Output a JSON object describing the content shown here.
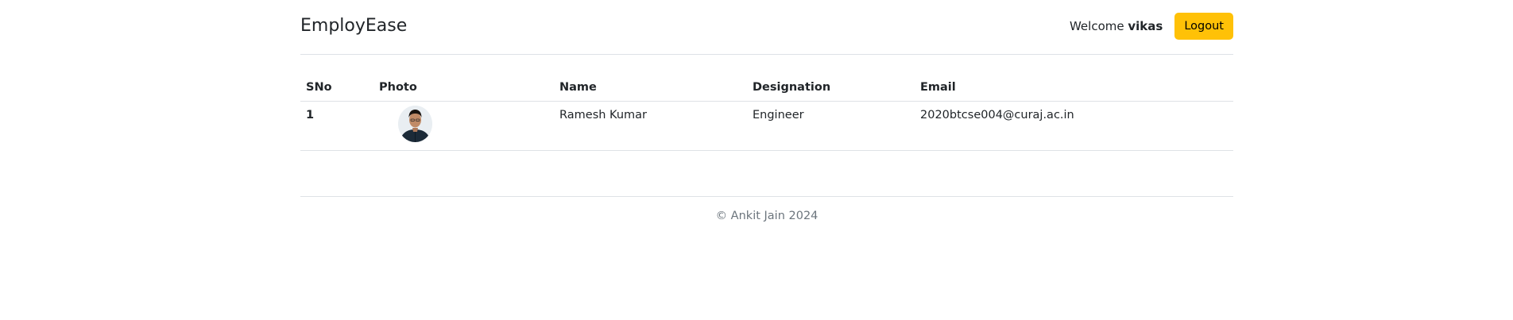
{
  "navbar": {
    "brand": "EmployEase",
    "welcome_prefix": "Welcome",
    "username": "vikas",
    "logout_label": "Logout"
  },
  "table": {
    "columns": [
      "SNo",
      "Photo",
      "Name",
      "Designation",
      "Email"
    ],
    "rows": [
      {
        "sno": "1",
        "photo": "employee-photo",
        "name": "Ramesh Kumar",
        "designation": "Engineer",
        "email": "2020btcse004@curaj.ac.in"
      }
    ]
  },
  "footer": {
    "text": "© Ankit Jain 2024"
  },
  "colors": {
    "logout_button": "#ffc107",
    "divider": "#dee2e6",
    "footer_text": "#6c757d"
  }
}
